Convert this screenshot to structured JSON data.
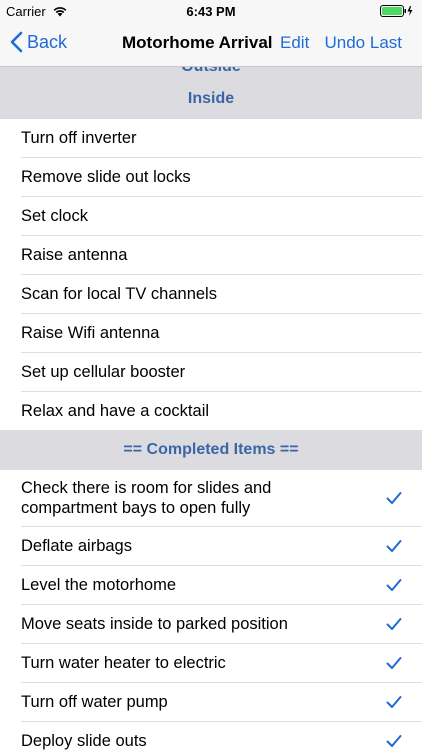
{
  "status": {
    "carrier": "Carrier",
    "time": "6:43 PM"
  },
  "nav": {
    "back_label": "Back",
    "title": "Motorhome Arrival",
    "edit_label": "Edit",
    "undo_label": "Undo Last"
  },
  "sections": {
    "outside_header": "Outside",
    "inside_header": "Inside",
    "completed_header": "== Completed Items =="
  },
  "inside_items": [
    "Turn off inverter",
    "Remove slide out locks",
    "Set clock",
    "Raise antenna",
    "Scan for local TV channels",
    "Raise Wifi antenna",
    "Set up cellular booster",
    "Relax and have a cocktail"
  ],
  "completed_items": [
    "Check there is room for slides and compartment bays to open fully",
    "Deflate airbags",
    "Level the motorhome",
    "Move seats inside to parked position",
    "Turn water heater to electric",
    "Turn off water pump",
    "Deploy slide outs"
  ],
  "colors": {
    "accent": "#1f6bd6",
    "section_text": "#3a66a8",
    "section_bg": "#dcdce0",
    "battery": "#4cd964"
  }
}
